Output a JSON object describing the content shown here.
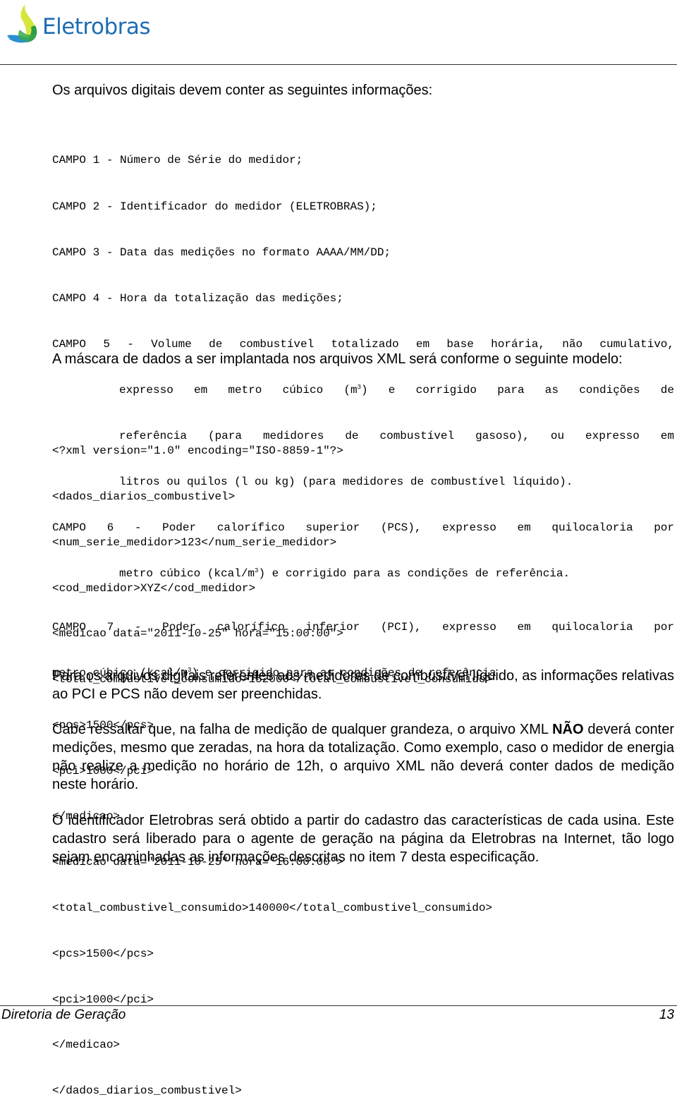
{
  "header": {
    "brand": "Eletrobras",
    "logo_icon": "eletrobras-flame-logo"
  },
  "intro": "Os arquivos digitais devem conter as seguintes informações:",
  "campos": [
    "CAMPO 1 - Número de Série do medidor;",
    "CAMPO 2 - Identificador do medidor (ELETROBRAS);",
    "CAMPO 3 - Data das medições no formato AAAA/MM/DD;",
    "CAMPO 4 - Hora da totalização das medições;"
  ],
  "campo5": {
    "head": "CAMPO 5 - Volume de combustível totalizado em base horária, não cumulativo,",
    "line1_a": "expresso em metro cúbico (m",
    "line1_sup": "3",
    "line1_b": ") e corrigido para as condições de",
    "line2": "referência (para medidores de combustível gasoso), ou expresso em",
    "line3": "litros ou quilos (l ou kg) (para medidores de combustível líquido)."
  },
  "campo6": {
    "head": "CAMPO 6 - Poder calorífico superior (PCS), expresso em quilocaloria por",
    "line1_a": "metro cúbico (kcal/m",
    "line1_sup": "3",
    "line1_b": ") e corrigido para as condições de referência."
  },
  "campo7": {
    "head": "CAMPO 7 - Poder calorífico inferior (PCI), expresso em quilocaloria por",
    "line1_a": "metro cúbico (kcal/m",
    "line1_sup": "3",
    "line1_b": ") e corrigido para as condições de referência"
  },
  "mask_intro": "A máscara de dados a ser implantada nos arquivos XML será conforme o seguinte modelo:",
  "xml_lines": [
    "<?xml version=\"1.0\" encoding=\"ISO-8859-1\"?>",
    "<dados_diarios_combustivel>",
    "<num_serie_medidor>123</num_serie_medidor>",
    "<cod_medidor>XYZ</cod_medidor>",
    "<medicao data=\"2011-10-25\" hora=\"15:00:00\">",
    "<total_combustivel_consumido>152000</total_combustivel_consumido>",
    "<pcs>1500</pcs>",
    "<pci>1000</pci>",
    "</medicao>",
    "<medicao data=\"2011-10-25\" hora=\"16:00:00\">",
    "<total_combustivel_consumido>140000</total_combustivel_consumido>",
    "<pcs>1500</pcs>",
    "<pci>1000</pci>",
    "</medicao>",
    "</dados_diarios_combustivel>"
  ],
  "para_liquido": "Para os arquivos digitais referentes aos medidores de combustível líquido, as informações relativas ao PCI e PCS não devem ser preenchidas.",
  "para_falha": {
    "before": "Cabe ressaltar que, na falha de medição de qualquer grandeza, o arquivo XML ",
    "bold": "NÃO",
    "after": " deverá conter medições, mesmo que zeradas, na hora da totalização. Como exemplo, caso o medidor de energia não realize a medição no horário de 12h, o arquivo XML não deverá conter dados de medição neste horário."
  },
  "para_identificador": "O identificador Eletrobras será obtido a partir do cadastro das características de cada usina. Este cadastro será liberado para o agente de geração na página da Eletrobras na Internet, tão logo sejam encaminhadas as informações descritas no item 7 desta especificação.",
  "footer": {
    "left": "Diretoria de Geração",
    "page_number": "13"
  }
}
